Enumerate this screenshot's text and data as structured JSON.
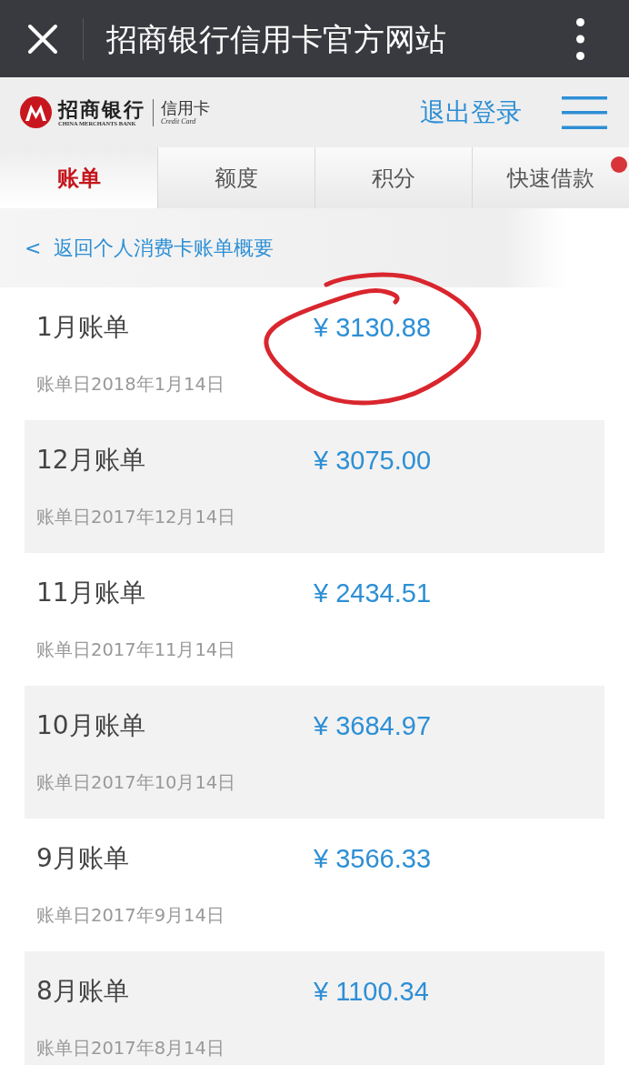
{
  "top_bar": {
    "title": "招商银行信用卡官方网站"
  },
  "header": {
    "logo": {
      "name_cn": "招商银行",
      "name_en": "CHINA MERCHANTS BANK",
      "product_cn": "信用卡",
      "product_en": "Credit Card"
    },
    "logout": "退出登录"
  },
  "tabs": [
    {
      "label": "账单",
      "selected": true,
      "dot": false
    },
    {
      "label": "额度",
      "selected": false,
      "dot": false
    },
    {
      "label": "积分",
      "selected": false,
      "dot": false
    },
    {
      "label": "快速借款",
      "selected": false,
      "dot": true
    }
  ],
  "back_link": "<  返回个人消费卡账单概要",
  "bills": [
    {
      "title": "1月账单",
      "amount": "¥ 3130.88",
      "date": "账单日2018年1月14日",
      "circled": true
    },
    {
      "title": "12月账单",
      "amount": "¥ 3075.00",
      "date": "账单日2017年12月14日",
      "circled": false
    },
    {
      "title": "11月账单",
      "amount": "¥ 2434.51",
      "date": "账单日2017年11月14日",
      "circled": false
    },
    {
      "title": "10月账单",
      "amount": "¥ 3684.97",
      "date": "账单日2017年10月14日",
      "circled": false
    },
    {
      "title": "9月账单",
      "amount": "¥ 3566.33",
      "date": "账单日2017年9月14日",
      "circled": false
    },
    {
      "title": "8月账单",
      "amount": "¥ 1100.34",
      "date": "账单日2017年8月14日",
      "circled": false
    }
  ]
}
